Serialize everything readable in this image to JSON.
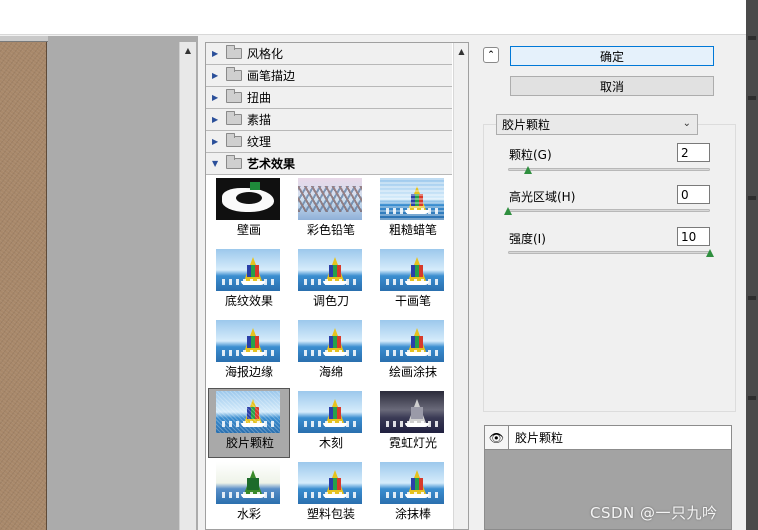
{
  "gallery": {
    "categories": [
      {
        "label": "风格化",
        "expanded": false
      },
      {
        "label": "画笔描边",
        "expanded": false
      },
      {
        "label": "扭曲",
        "expanded": false
      },
      {
        "label": "素描",
        "expanded": false
      },
      {
        "label": "纹理",
        "expanded": false
      },
      {
        "label": "艺术效果",
        "expanded": true
      }
    ],
    "filters": [
      {
        "label": "壁画",
        "selected": false
      },
      {
        "label": "彩色铅笔",
        "selected": false
      },
      {
        "label": "粗糙蜡笔",
        "selected": false
      },
      {
        "label": "底纹效果",
        "selected": false
      },
      {
        "label": "调色刀",
        "selected": false
      },
      {
        "label": "干画笔",
        "selected": false
      },
      {
        "label": "海报边缘",
        "selected": false
      },
      {
        "label": "海绵",
        "selected": false
      },
      {
        "label": "绘画涂抹",
        "selected": false
      },
      {
        "label": "胶片颗粒",
        "selected": true
      },
      {
        "label": "木刻",
        "selected": false
      },
      {
        "label": "霓虹灯光",
        "selected": false
      },
      {
        "label": "水彩",
        "selected": false
      },
      {
        "label": "塑料包装",
        "selected": false
      },
      {
        "label": "涂抹棒",
        "selected": false
      }
    ]
  },
  "controls": {
    "collapse_glyph": "⌃",
    "ok_label": "确定",
    "cancel_label": "取消",
    "filter_select": {
      "value": "胶片颗粒"
    },
    "params": [
      {
        "label": "颗粒(G)",
        "value": "2",
        "slider_fraction": 0.1
      },
      {
        "label": "高光区域(H)",
        "value": "0",
        "slider_fraction": 0.0
      },
      {
        "label": "强度(I)",
        "value": "10",
        "slider_fraction": 1.0
      }
    ]
  },
  "layers": {
    "items": [
      {
        "label": "胶片颗粒",
        "visible": true
      }
    ]
  },
  "watermark": "CSDN @一只九吟",
  "colors": {
    "accent": "#0078d7",
    "slider_thumb": "#2f8f3f",
    "tree_triangle": "#2a4f9a"
  }
}
